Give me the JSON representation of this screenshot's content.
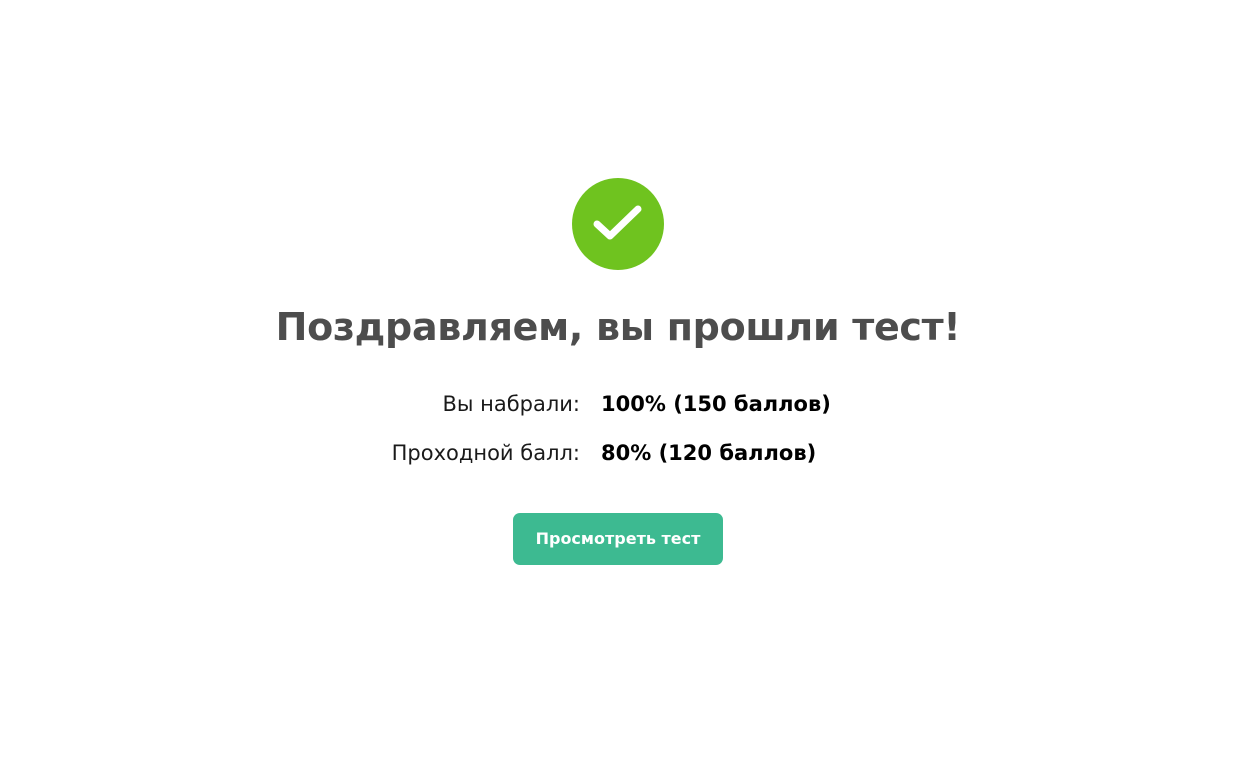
{
  "result": {
    "icon": "checkmark-circle-icon",
    "title": "Поздравляем, вы прошли тест!",
    "rows": [
      {
        "label": "Вы набрали:",
        "value": "100% (150 баллов)"
      },
      {
        "label": "Проходной балл:",
        "value": "80% (120 баллов)"
      }
    ],
    "button_label": "Просмотреть тест"
  },
  "colors": {
    "success": "#6fc31f",
    "button": "#3dba91",
    "title": "#4d4d4d"
  }
}
